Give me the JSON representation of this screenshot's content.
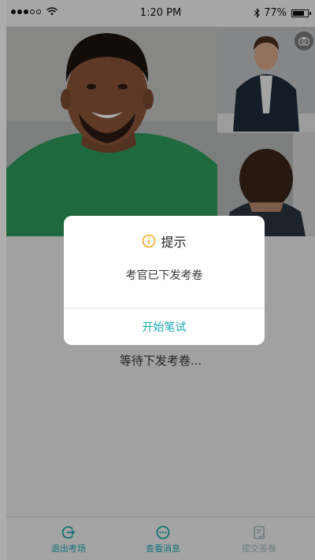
{
  "status_bar": {
    "time": "1:20 PM",
    "battery_text": "77%",
    "battery_level": 0.77,
    "signal_bars_filled": 3,
    "signal_bars_total": 5
  },
  "colors": {
    "accent": "#1aa7b4",
    "tab_active": "#1aa7b4",
    "tab_disabled": "#9fb8bb",
    "info_icon": "#f5a623"
  },
  "main": {
    "waiting_text": "等待下发考卷..."
  },
  "tabbar": {
    "items": [
      {
        "label": "退出考场",
        "icon": "exit-icon",
        "enabled": true
      },
      {
        "label": "查看消息",
        "icon": "message-icon",
        "enabled": true
      },
      {
        "label": "提交答卷",
        "icon": "submit-document-icon",
        "enabled": false
      }
    ]
  },
  "dialog": {
    "icon": "info-icon",
    "title": "提示",
    "message": "考官已下发考卷",
    "button_label": "开始笔试"
  }
}
